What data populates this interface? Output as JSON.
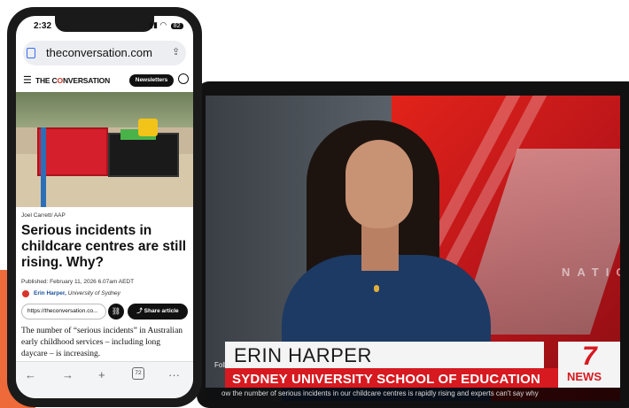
{
  "phone": {
    "status": {
      "time": "2:32",
      "battery": "82"
    },
    "browser": {
      "url": "theconversation.com"
    },
    "site": {
      "brand_prefix": "THE C",
      "brand_o": "O",
      "brand_suffix": "NVERSATION",
      "newsletters_label": "Newsletters"
    },
    "article": {
      "photo_credit": "Joel Carrett/ AAP",
      "headline": "Serious incidents in childcare centres are still rising. Why?",
      "published": "Published: February 11, 2026 6.07am AEDT",
      "author_name": "Erin Harper,",
      "author_affiliation": "University of Sydney",
      "share_link": "https://theconversation.co...",
      "share_button": "Share article",
      "body": "The number of “serious incidents” in Australian early childhood services – including long daycare – is increasing."
    },
    "toolbar": {
      "back": "←",
      "forward": "→",
      "new_tab": "+",
      "tabs_count": "72",
      "more": "···"
    }
  },
  "tv": {
    "backdrop_text": "NATIO",
    "lower_third_name": "ERIN HARPER",
    "lower_third_title": "SYDNEY UNIVERSITY SCHOOL OF EDUCATION",
    "channel_number": "7",
    "channel_name": "NEWS",
    "follow_label": "Follow",
    "ticker": "ow the number of serious incidents in our childcare centres is rapidly rising and experts can't say why"
  },
  "colors": {
    "accent_orange": "#ef6a3a",
    "news_red": "#d71920",
    "brand_red": "#d8352a"
  }
}
